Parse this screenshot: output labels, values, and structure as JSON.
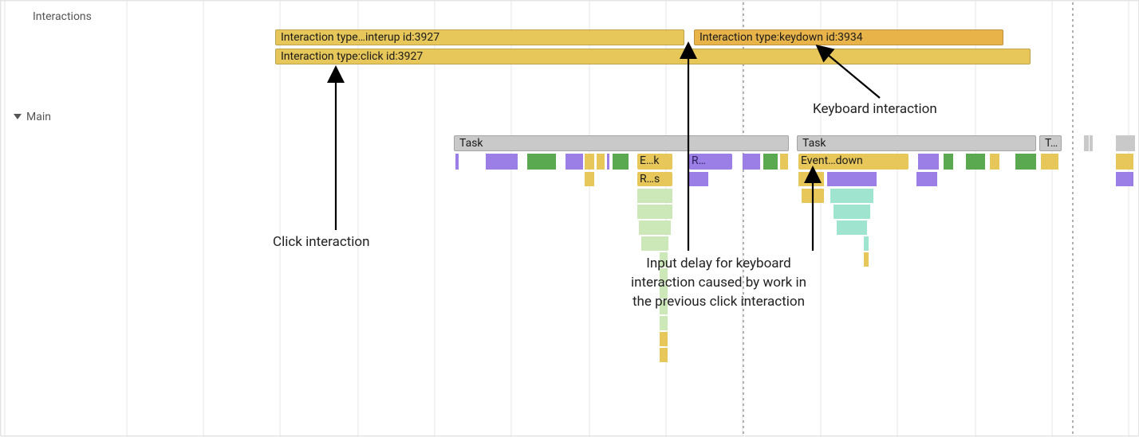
{
  "labels": {
    "interactions": "Interactions",
    "main": "Main"
  },
  "interactions": {
    "pointerup": "Interaction type…interup id:3927",
    "click": "Interaction type:click id:3927",
    "keydown": "Interaction type:keydown id:3934"
  },
  "tasks": {
    "label": "Task",
    "truncated": "T…"
  },
  "events": {
    "ek": "E…k",
    "r": "R…",
    "rs": "R…s",
    "eventdown": "Event…down"
  },
  "annotations": {
    "click": "Click interaction",
    "keyboard": "Keyboard interaction",
    "inputDelay1": "Input delay for keyboard",
    "inputDelay2": "interaction caused by work in",
    "inputDelay3": "the previous click interaction"
  },
  "colors": {
    "yellow": "#e7c75a",
    "orange": "#e8b44a",
    "gray": "#c9c9c9",
    "purple": "#9b7ee6",
    "green": "#5aa84f",
    "paleGreen": "#cde8b8",
    "mint": "#9fe4cf"
  }
}
